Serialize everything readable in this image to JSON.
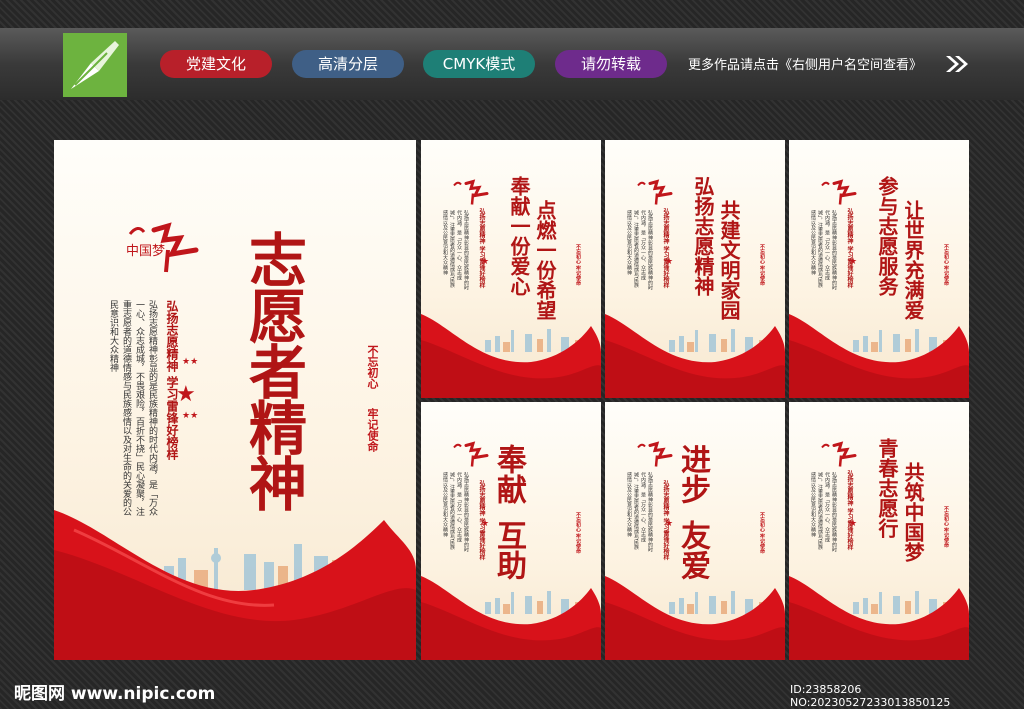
{
  "header": {
    "tags": [
      {
        "label": "党建文化",
        "color": "#b8202a"
      },
      {
        "label": "高清分层",
        "color": "#3f5f86"
      },
      {
        "label": "CMYK模式",
        "color": "#1e7f76"
      },
      {
        "label": "请勿转载",
        "color": "#6e2b8c"
      }
    ],
    "more_text": "更多作品请点击《右侧用户名空间查看》"
  },
  "main_poster": {
    "title": "志愿者精神",
    "subtitle": "弘扬志愿精神 学习雷锋好榜样",
    "body": "弘扬志愿精神彰显的是民族精神的时代内涵，是「万众一心、众志成城，不畏艰险，百折不挠」民心凝聚，注重志愿者的道德情感与民族感情以及对生命的关爱的公民意识和大众精神",
    "seal_left": "不忘初心",
    "seal_right": "牢记使命"
  },
  "small_posters": [
    {
      "col1": "奉献一份爱心",
      "col2": "点燃一份希望"
    },
    {
      "col1": "弘扬志愿精神",
      "col2": "共建文明家园"
    },
    {
      "col1": "参与志愿服务",
      "col2": "让世界充满爱"
    },
    {
      "col1": "奉献",
      "col2": "互助"
    },
    {
      "col1": "进步",
      "col2": "友爱"
    },
    {
      "col1": "青春志愿行",
      "col2": "共筑中国梦"
    }
  ],
  "small_poster_common": {
    "subtitle": "弘扬志愿精神 学习雷锋好榜样",
    "body": "弘扬志愿精神彰显的是民族精神的时代内涵，是「万众一心、众志成城」，注重志愿者的道德情感与民族感情以及公民意识和大众精神",
    "seal": "不忘初心 牢记使命"
  },
  "logo_text": "中国梦",
  "footer": {
    "site": "昵图网 www.nipic.com",
    "id": "ID:23858206 NO:20230527233013850125"
  },
  "colors": {
    "accent_red": "#c0161b",
    "poster_bg": "#fdf3e2"
  }
}
